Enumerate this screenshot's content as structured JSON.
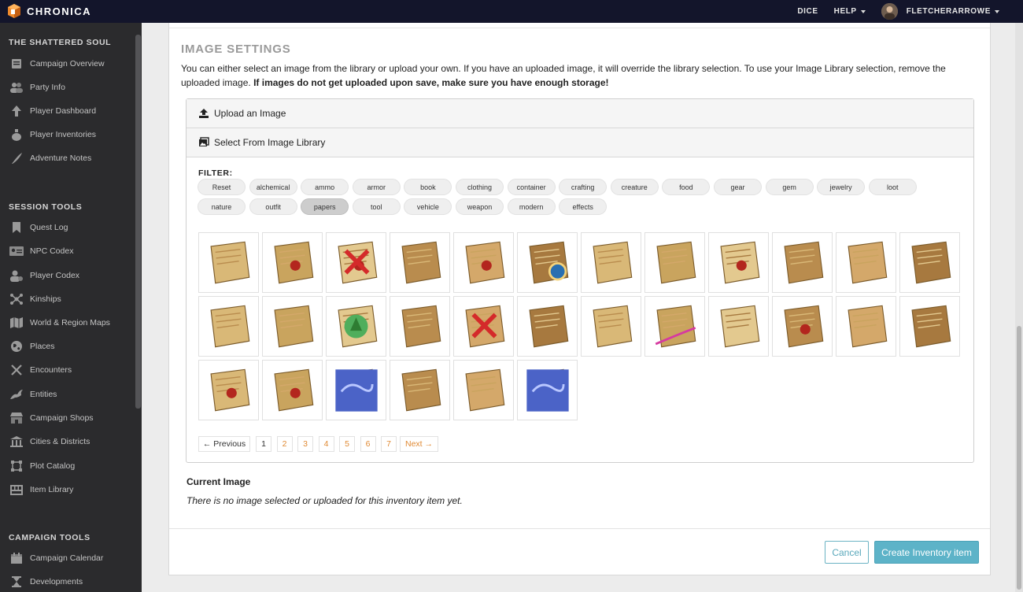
{
  "brand": {
    "name": "CHRONICA",
    "logo_icon": "chronica-cube-logo",
    "logo_color": "#f08a2c"
  },
  "topnav": {
    "dice": "DICE",
    "help": "HELP",
    "username": "FLETCHERARROWE"
  },
  "sidebar": {
    "campaign_name": "THE SHATTERED SOUL",
    "campaign_items": [
      {
        "label": "Campaign Overview",
        "icon": "book-icon"
      },
      {
        "label": "Party Info",
        "icon": "party-icon"
      },
      {
        "label": "Player Dashboard",
        "icon": "arrow-up-icon"
      },
      {
        "label": "Player Inventories",
        "icon": "potion-icon"
      },
      {
        "label": "Adventure Notes",
        "icon": "quill-icon"
      }
    ],
    "session_title": "SESSION TOOLS",
    "session_items": [
      {
        "label": "Quest Log",
        "icon": "bookmark-icon"
      },
      {
        "label": "NPC Codex",
        "icon": "id-card-icon"
      },
      {
        "label": "Player Codex",
        "icon": "player-icon"
      },
      {
        "label": "Kinships",
        "icon": "network-icon"
      },
      {
        "label": "World & Region Maps",
        "icon": "map-icon"
      },
      {
        "label": "Places",
        "icon": "globe-icon"
      },
      {
        "label": "Encounters",
        "icon": "swords-icon"
      },
      {
        "label": "Entities",
        "icon": "dragon-icon"
      },
      {
        "label": "Campaign Shops",
        "icon": "shop-icon"
      },
      {
        "label": "Cities & Districts",
        "icon": "building-icon"
      },
      {
        "label": "Plot Catalog",
        "icon": "plot-icon"
      },
      {
        "label": "Item Library",
        "icon": "chest-icon"
      }
    ],
    "campaign_tools_title": "CAMPAIGN TOOLS",
    "campaign_tools_items": [
      {
        "label": "Campaign Calendar",
        "icon": "calendar-icon"
      },
      {
        "label": "Developments",
        "icon": "hourglass-icon"
      }
    ]
  },
  "image_settings": {
    "title": "IMAGE SETTINGS",
    "description": "You can either select an image from the library or upload your own. If you have an uploaded image, it will override the library selection. To use your Image Library selection, remove the uploaded image.",
    "warning": "If images do not get uploaded upon save, make sure you have enough storage!",
    "upload_label": "Upload an Image",
    "library_label": "Select From Image Library",
    "filter_label": "FILTER:",
    "filters_row1": [
      "Reset",
      "alchemical",
      "ammo",
      "armor",
      "book",
      "clothing",
      "container",
      "crafting",
      "creature",
      "food",
      "gear",
      "gem",
      "jewelry",
      "loot"
    ],
    "filters_row2": [
      "nature",
      "outfit",
      "papers",
      "tool",
      "vehicle",
      "weapon",
      "modern",
      "effects"
    ],
    "active_filter": "papers",
    "thumbnails": [
      "folded-map",
      "sealed-envelope",
      "wax-sealed-letter",
      "rolled-scroll",
      "certificate-with-ribbon",
      "map-with-compass",
      "yellow-scroll",
      "bundled-scrolls",
      "document-with-seal",
      "tall-scroll",
      "stack-of-papers",
      "curled-parchment",
      "parchment-sheet",
      "rolled-parchment",
      "tree-map",
      "anchor-card",
      "treasure-map-x",
      "rune-parchment",
      "old-map-dark",
      "quill-and-paper",
      "treasure-map-gold",
      "envelope-red-seal",
      "torn-scroll",
      "rune-stone-tablet",
      "letter-b-page",
      "sealed-certificate",
      "blue-tome",
      "tan-scroll",
      "map-scroll",
      "blue-magic-scroll"
    ],
    "pagination": {
      "previous": "← Previous",
      "pages": [
        "1",
        "2",
        "3",
        "4",
        "5",
        "6",
        "7"
      ],
      "current": "1",
      "next": "Next →"
    },
    "current_image_title": "Current Image",
    "current_image_text": "There is no image selected or uploaded for this inventory item yet."
  },
  "actions": {
    "cancel": "Cancel",
    "create": "Create Inventory item"
  },
  "colors": {
    "topbar": "#13152b",
    "sidebar": "#2b2b2d",
    "accent": "#5db3c8",
    "pagination_link": "#e08a34"
  }
}
